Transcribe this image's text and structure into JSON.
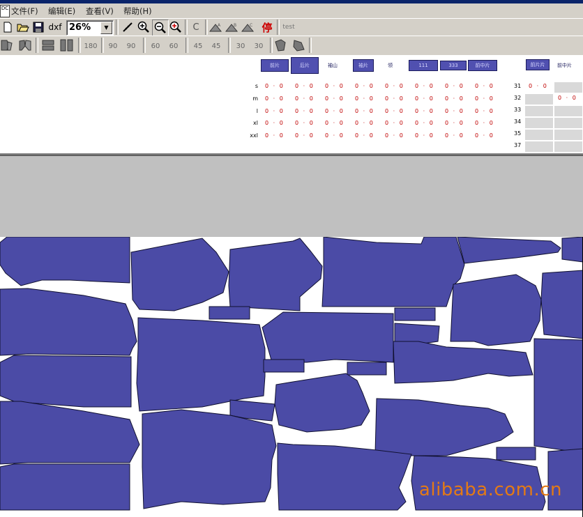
{
  "menu": {
    "app_icon_text": "DC",
    "items": [
      {
        "label": "文件(F)"
      },
      {
        "label": "编辑(E)"
      },
      {
        "label": "查看(V)"
      },
      {
        "label": "帮助(H)"
      }
    ]
  },
  "toolbar": {
    "dxf_label": "dxf",
    "zoom_value": "26%",
    "c_label": "C",
    "stop_label": "停",
    "test_label": "test"
  },
  "rotate_toolbar": {
    "labels": [
      "180",
      "90",
      "90",
      "60",
      "60",
      "45",
      "45",
      "30",
      "30"
    ]
  },
  "size_table": {
    "piece_headers": [
      "前片",
      "后片",
      "袖山",
      "袖片",
      "领",
      "111",
      "333",
      "前中片"
    ],
    "rows": [
      {
        "label": "s",
        "cells": [
          "0 · 0",
          "0 · 0",
          "0 · 0",
          "0 · 0",
          "0 · 0",
          "0 · 0",
          "0 · 0",
          "0 · 0"
        ]
      },
      {
        "label": "m",
        "cells": [
          "0 · 0",
          "0 · 0",
          "0 · 0",
          "0 · 0",
          "0 · 0",
          "0 · 0",
          "0 · 0",
          "0 · 0"
        ]
      },
      {
        "label": "l",
        "cells": [
          "0 · 0",
          "0 · 0",
          "0 · 0",
          "0 · 0",
          "0 · 0",
          "0 · 0",
          "0 · 0",
          "0 · 0"
        ]
      },
      {
        "label": "xl",
        "cells": [
          "0 · 0",
          "0 · 0",
          "0 · 0",
          "0 · 0",
          "0 · 0",
          "0 · 0",
          "0 · 0",
          "0 · 0"
        ]
      },
      {
        "label": "xxl",
        "cells": [
          "0 · 0",
          "0 · 0",
          "0 · 0",
          "0 · 0",
          "0 · 0",
          "0 · 0",
          "0 · 0",
          "0 · 0"
        ]
      }
    ],
    "right_headers": [
      "前片片",
      "前中片"
    ],
    "right_rows": [
      {
        "num": "31",
        "c1": "0 · 0",
        "c2": ""
      },
      {
        "num": "32",
        "c1": "",
        "c2": "0 · 0"
      },
      {
        "num": "33",
        "c1": "",
        "c2": ""
      },
      {
        "num": "34",
        "c1": "",
        "c2": ""
      },
      {
        "num": "35",
        "c1": "",
        "c2": ""
      },
      {
        "num": "37",
        "c1": "",
        "c2": ""
      }
    ]
  },
  "colors": {
    "piece_fill": "#4b4ba6",
    "piece_stroke": "#101030",
    "cell_text": "#c00000",
    "watermark": "#e37a16"
  },
  "watermark": "alibaba.com.cn"
}
